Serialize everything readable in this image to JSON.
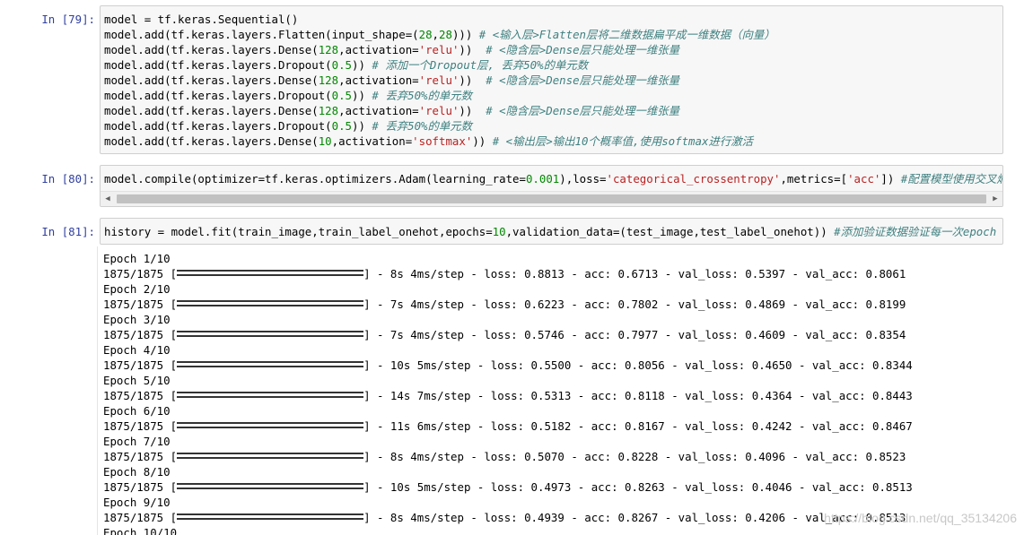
{
  "cells": [
    {
      "prompt": "In  [79]:",
      "lines": [
        [
          {
            "t": "model = tf.keras.Sequential()",
            "c": "kw"
          }
        ],
        [
          {
            "t": "model.add(tf.keras.layers.Flatten(input_shape=(",
            "c": "kw"
          },
          {
            "t": "28",
            "c": "num"
          },
          {
            "t": ",",
            "c": "kw"
          },
          {
            "t": "28",
            "c": "num"
          },
          {
            "t": "))) ",
            "c": "kw"
          },
          {
            "t": "# <输入层>Flatten层将二维数据扁平成一维数据（向量）",
            "c": "cm"
          }
        ],
        [
          {
            "t": "model.add(tf.keras.layers.Dense(",
            "c": "kw"
          },
          {
            "t": "128",
            "c": "num"
          },
          {
            "t": ",activation=",
            "c": "kw"
          },
          {
            "t": "'relu'",
            "c": "str"
          },
          {
            "t": "))  ",
            "c": "kw"
          },
          {
            "t": "# <隐含层>Dense层只能处理一维张量",
            "c": "cm"
          }
        ],
        [
          {
            "t": "model.add(tf.keras.layers.Dropout(",
            "c": "kw"
          },
          {
            "t": "0.5",
            "c": "num"
          },
          {
            "t": ")) ",
            "c": "kw"
          },
          {
            "t": "# 添加一个Dropout层, 丢弃50%的单元数",
            "c": "cm"
          }
        ],
        [
          {
            "t": "model.add(tf.keras.layers.Dense(",
            "c": "kw"
          },
          {
            "t": "128",
            "c": "num"
          },
          {
            "t": ",activation=",
            "c": "kw"
          },
          {
            "t": "'relu'",
            "c": "str"
          },
          {
            "t": "))  ",
            "c": "kw"
          },
          {
            "t": "# <隐含层>Dense层只能处理一维张量",
            "c": "cm"
          }
        ],
        [
          {
            "t": "model.add(tf.keras.layers.Dropout(",
            "c": "kw"
          },
          {
            "t": "0.5",
            "c": "num"
          },
          {
            "t": ")) ",
            "c": "kw"
          },
          {
            "t": "# 丢弃50%的单元数",
            "c": "cm"
          }
        ],
        [
          {
            "t": "model.add(tf.keras.layers.Dense(",
            "c": "kw"
          },
          {
            "t": "128",
            "c": "num"
          },
          {
            "t": ",activation=",
            "c": "kw"
          },
          {
            "t": "'relu'",
            "c": "str"
          },
          {
            "t": "))  ",
            "c": "kw"
          },
          {
            "t": "# <隐含层>Dense层只能处理一维张量",
            "c": "cm"
          }
        ],
        [
          {
            "t": "model.add(tf.keras.layers.Dropout(",
            "c": "kw"
          },
          {
            "t": "0.5",
            "c": "num"
          },
          {
            "t": ")) ",
            "c": "kw"
          },
          {
            "t": "# 丢弃50%的单元数",
            "c": "cm"
          }
        ],
        [
          {
            "t": "model.add(tf.keras.layers.Dense(",
            "c": "kw"
          },
          {
            "t": "10",
            "c": "num"
          },
          {
            "t": ",activation=",
            "c": "kw"
          },
          {
            "t": "'softmax'",
            "c": "str"
          },
          {
            "t": ")) ",
            "c": "kw"
          },
          {
            "t": "# <输出层>输出10个概率值,使用softmax进行激活",
            "c": "cm"
          }
        ]
      ]
    },
    {
      "prompt": "In  [80]:",
      "lines": [
        [
          {
            "t": "model.compile(optimizer=tf.keras.optimizers.Adam(learning_rate=",
            "c": "kw"
          },
          {
            "t": "0.001",
            "c": "num"
          },
          {
            "t": "),loss=",
            "c": "kw"
          },
          {
            "t": "'categorical_crossentropy'",
            "c": "str"
          },
          {
            "t": ",metrics=[",
            "c": "kw"
          },
          {
            "t": "'acc'",
            "c": "str"
          },
          {
            "t": "]) ",
            "c": "kw"
          },
          {
            "t": "#配置模型使用交叉熵损失函数",
            "c": "cm"
          }
        ]
      ]
    },
    {
      "prompt": "In  [81]:",
      "lines": [
        [
          {
            "t": "history = model.fit(train_image,train_label_onehot,epochs=",
            "c": "kw"
          },
          {
            "t": "10",
            "c": "num"
          },
          {
            "t": ",validation_data=(test_image,test_label_onehot)) ",
            "c": "kw"
          },
          {
            "t": "#添加验证数据验证每一次epoch",
            "c": "cm"
          }
        ]
      ]
    }
  ],
  "output": {
    "epochs": [
      {
        "epoch": "Epoch 1/10",
        "steps": "1875/1875",
        "stats": "] - 8s 4ms/step - loss: 0.8813 - acc: 0.6713 - val_loss: 0.5397 - val_acc: 0.8061"
      },
      {
        "epoch": "Epoch 2/10",
        "steps": "1875/1875",
        "stats": "] - 7s 4ms/step - loss: 0.6223 - acc: 0.7802 - val_loss: 0.4869 - val_acc: 0.8199"
      },
      {
        "epoch": "Epoch 3/10",
        "steps": "1875/1875",
        "stats": "] - 7s 4ms/step - loss: 0.5746 - acc: 0.7977 - val_loss: 0.4609 - val_acc: 0.8354"
      },
      {
        "epoch": "Epoch 4/10",
        "steps": "1875/1875",
        "stats": "] - 10s 5ms/step - loss: 0.5500 - acc: 0.8056 - val_loss: 0.4650 - val_acc: 0.8344"
      },
      {
        "epoch": "Epoch 5/10",
        "steps": "1875/1875",
        "stats": "] - 14s 7ms/step - loss: 0.5313 - acc: 0.8118 - val_loss: 0.4364 - val_acc: 0.8443"
      },
      {
        "epoch": "Epoch 6/10",
        "steps": "1875/1875",
        "stats": "] - 11s 6ms/step - loss: 0.5182 - acc: 0.8167 - val_loss: 0.4242 - val_acc: 0.8467"
      },
      {
        "epoch": "Epoch 7/10",
        "steps": "1875/1875",
        "stats": "] - 8s 4ms/step - loss: 0.5070 - acc: 0.8228 - val_loss: 0.4096 - val_acc: 0.8523"
      },
      {
        "epoch": "Epoch 8/10",
        "steps": "1875/1875",
        "stats": "] - 10s 5ms/step - loss: 0.4973 - acc: 0.8263 - val_loss: 0.4046 - val_acc: 0.8513"
      },
      {
        "epoch": "Epoch 9/10",
        "steps": "1875/1875",
        "stats": "] - 8s 4ms/step - loss: 0.4939 - acc: 0.8267 - val_loss: 0.4206 - val_acc: 0.8513"
      },
      {
        "epoch": "Epoch 10/10",
        "steps": "",
        "stats": ""
      }
    ]
  },
  "watermark": "https://blog.csdn.net/qq_35134206",
  "colors": {
    "prompt": "#303f9f",
    "number": "#008800",
    "string": "#ba2121",
    "comment": "#408080"
  }
}
